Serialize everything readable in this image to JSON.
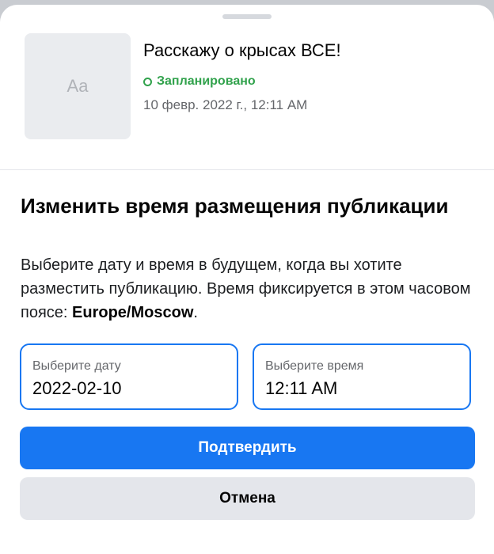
{
  "post": {
    "thumbnail_text": "Aa",
    "title": "Расскажу о крысах ВСЕ!",
    "status": "Запланировано",
    "scheduled_time": "10 февр. 2022 г., 12:11 AM"
  },
  "reschedule": {
    "heading": "Изменить время размещения публикации",
    "description_prefix": "Выберите дату и время в будущем, когда вы хотите разместить публикацию. Время фиксируется в этом часовом поясе: ",
    "timezone": "Europe/Moscow",
    "description_suffix": "."
  },
  "date_field": {
    "label": "Выберите дату",
    "value": "2022-02-10"
  },
  "time_field": {
    "label": "Выберите время",
    "value": "12:11 AM"
  },
  "buttons": {
    "confirm": "Подтвердить",
    "cancel": "Отмена"
  },
  "colors": {
    "accent": "#1877f2",
    "status_green": "#31a24c",
    "secondary_button": "#e4e6eb"
  }
}
